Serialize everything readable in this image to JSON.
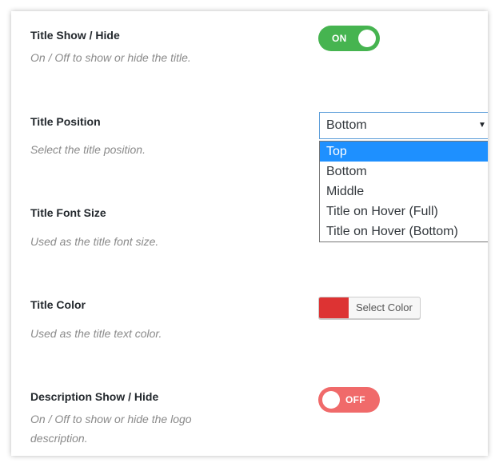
{
  "title_show": {
    "label": "Title Show / Hide",
    "description": "On / Off to show or hide the title.",
    "toggle_text": "ON",
    "toggle_state": "on",
    "toggle_color": "#46b450"
  },
  "title_position": {
    "label": "Title Position",
    "description": "Select the title position.",
    "selected_value": "Bottom",
    "arrow_glyph": "▼",
    "options": [
      "Top",
      "Bottom",
      "Middle",
      "Title on Hover (Full)",
      "Title on Hover (Bottom)"
    ],
    "highlighted_option": "Top",
    "highlight_color": "#1e90ff"
  },
  "title_font_size": {
    "label": "Title Font Size",
    "description": "Used as the title font size."
  },
  "title_color": {
    "label": "Title Color",
    "description": "Used as the title text color.",
    "button_label": "Select Color",
    "swatch_color": "#dd3333"
  },
  "description_show": {
    "label": "Description Show / Hide",
    "description_line1": "On / Off to show or hide the logo",
    "description_line2": "description.",
    "toggle_text": "OFF",
    "toggle_state": "off",
    "toggle_color": "#f06a6a"
  }
}
